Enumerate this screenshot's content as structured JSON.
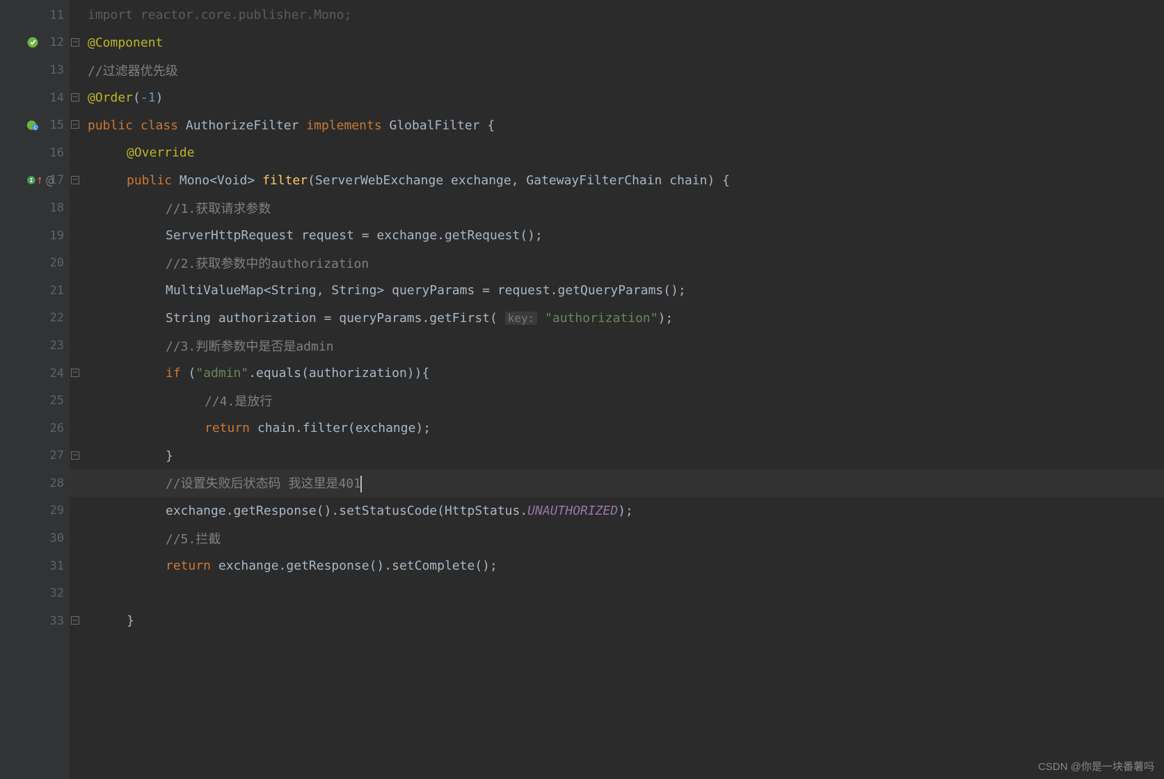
{
  "watermark": "CSDN @你是一块番薯吗",
  "lines": [
    {
      "n": 11,
      "html": "<span class='tok-keyword tok-dim'>import</span><span class='tok-dim'> reactor.core.publisher.Mono;</span>"
    },
    {
      "n": 12,
      "icon": "spring",
      "fold": "start",
      "html": "<span class='tok-annotation'>@Component</span>"
    },
    {
      "n": 13,
      "html": "<span class='tok-comment'>//过滤器优先级</span>"
    },
    {
      "n": 14,
      "fold": "end",
      "html": "<span class='tok-annotation'>@Order</span><span class='tok-punct'>(</span><span class='tok-number'>-1</span><span class='tok-punct'>)</span>"
    },
    {
      "n": 15,
      "icon": "class",
      "fold": "start",
      "html": "<span class='tok-keyword'>public class </span><span class='tok-type'>AuthorizeFilter </span><span class='tok-keyword'>implements </span><span class='tok-type'>GlobalFilter {</span>"
    },
    {
      "n": 16,
      "html": "    <span class='tok-annotation'>@Override</span>"
    },
    {
      "n": 17,
      "icon": "override",
      "fold": "start",
      "html": "    <span class='tok-keyword'>public </span><span class='tok-type'>Mono&lt;Void&gt; </span><span class='tok-method'>filter</span><span class='tok-punct'>(ServerWebExchange exchange, GatewayFilterChain chain) {</span>"
    },
    {
      "n": 18,
      "html": "        <span class='tok-comment'>//1.获取请求参数</span>"
    },
    {
      "n": 19,
      "html": "        <span class='tok-type'>ServerHttpRequest request = exchange.getRequest();</span>"
    },
    {
      "n": 20,
      "html": "        <span class='tok-comment'>//2.获取参数中的authorization</span>"
    },
    {
      "n": 21,
      "html": "        <span class='tok-type'>MultiValueMap&lt;String, String&gt; queryParams = request.getQueryParams();</span>"
    },
    {
      "n": 22,
      "html": "        <span class='tok-type'>String authorization = queryParams.getFirst(</span> <span class='tok-hint'>key:</span> <span class='tok-string'>\"authorization\"</span><span class='tok-punct'>);</span>"
    },
    {
      "n": 23,
      "html": "        <span class='tok-comment'>//3.判断参数中是否是admin</span>"
    },
    {
      "n": 24,
      "fold": "start",
      "html": "        <span class='tok-keyword'>if </span><span class='tok-punct'>(</span><span class='tok-string'>\"admin\"</span><span class='tok-punct'>.equals(authorization)){</span>"
    },
    {
      "n": 25,
      "html": "            <span class='tok-comment'>//4.是放行</span>"
    },
    {
      "n": 26,
      "html": "            <span class='tok-keyword'>return </span><span class='tok-type'>chain.filter(exchange);</span>"
    },
    {
      "n": 27,
      "fold": "end",
      "html": "        <span class='tok-punct'>}</span>"
    },
    {
      "n": 28,
      "highlighted": true,
      "html": "        <span class='tok-comment'>//设置失败后状态码 我这里是401</span><span class='caret'></span>"
    },
    {
      "n": 29,
      "html": "        <span class='tok-type'>exchange.getResponse().setStatusCode(HttpStatus.</span><span class='tok-static'>UNAUTHORIZED</span><span class='tok-punct'>);</span>"
    },
    {
      "n": 30,
      "html": "        <span class='tok-comment'>//5.拦截</span>"
    },
    {
      "n": 31,
      "html": "        <span class='tok-keyword'>return </span><span class='tok-type'>exchange.getResponse().setComplete();</span>"
    },
    {
      "n": 32,
      "html": ""
    },
    {
      "n": 33,
      "fold": "end",
      "html": "    <span class='tok-punct'>}</span>"
    }
  ]
}
